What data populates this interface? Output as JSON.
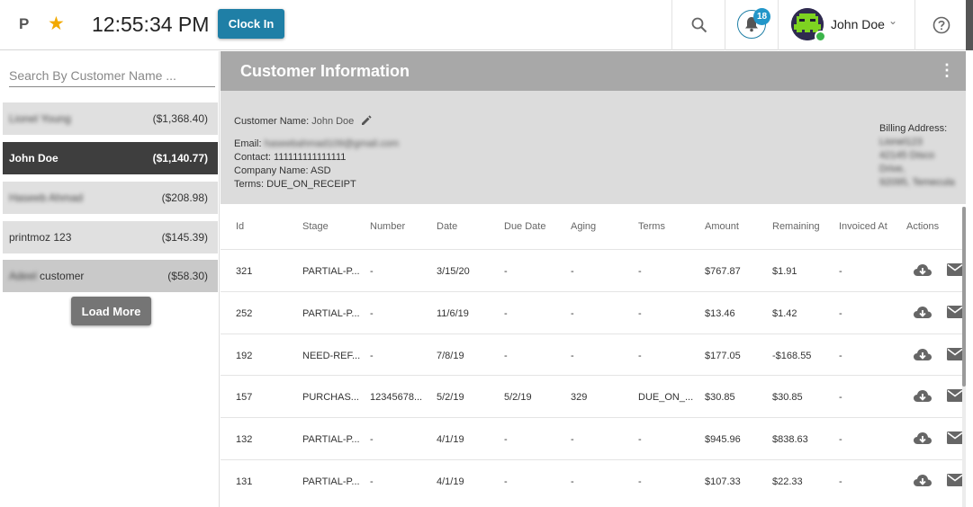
{
  "topbar": {
    "brand_letter": "P",
    "star_icon": "star-icon",
    "time": "12:55:34 PM",
    "clock_in_label": "Clock In",
    "notification_count": "18",
    "user_name": "John Doe",
    "accent_color": "#1f7fa6"
  },
  "sidebar": {
    "search_placeholder": "Search By Customer Name ...",
    "customers": [
      {
        "name": "Lionel Young",
        "balance": "($1,368.40)",
        "name_blurred": true
      },
      {
        "name": "John  Doe",
        "balance": "($1,140.77)",
        "name_blurred": false
      },
      {
        "name": "Haseeb Ahmad",
        "balance": "($208.98)",
        "name_blurred": true
      },
      {
        "name": "printmoz  123",
        "balance": "($145.39)",
        "name_blurred": false
      },
      {
        "name_blurred_part": "Adeel",
        "name_rest": "customer",
        "balance": "($58.30)"
      }
    ],
    "load_more_label": "Load More"
  },
  "customer_info": {
    "title": "Customer Information",
    "name_label": "Customer Name:",
    "name_value": "John  Doe",
    "email_label": "Email:",
    "email_value": "haseebahmad109@gmail.com",
    "contact_label": "Contact:",
    "contact_value": "111111111111111",
    "company_label": "Company Name:",
    "company_value": "ASD",
    "terms_label": "Terms:",
    "terms_value": "DUE_ON_RECEIPT",
    "billing_label": "Billing Address:",
    "billing_lines": [
      "Lionel123",
      "42145 Disco Drive,",
      "92095, Temecula"
    ]
  },
  "invoices": {
    "columns": [
      "Id",
      "Stage",
      "Number",
      "Date",
      "Due Date",
      "Aging",
      "Terms",
      "Amount",
      "Remaining",
      "Invoiced At",
      "Actions"
    ],
    "rows": [
      {
        "id": "321",
        "stage": "PARTIAL-P...",
        "number": "-",
        "date": "3/15/20",
        "due_date": "-",
        "aging": "-",
        "terms": "-",
        "amount": "$767.87",
        "remaining": "$1.91",
        "invoiced_at": "-"
      },
      {
        "id": "252",
        "stage": "PARTIAL-P...",
        "number": "-",
        "date": "11/6/19",
        "due_date": "-",
        "aging": "-",
        "terms": "-",
        "amount": "$13.46",
        "remaining": "$1.42",
        "invoiced_at": "-"
      },
      {
        "id": "192",
        "stage": "NEED-REF...",
        "number": "-",
        "date": "7/8/19",
        "due_date": "-",
        "aging": "-",
        "terms": "-",
        "amount": "$177.05",
        "remaining": "-$168.55",
        "invoiced_at": "-"
      },
      {
        "id": "157",
        "stage": "PURCHAS...",
        "number": "12345678...",
        "date": "5/2/19",
        "due_date": "5/2/19",
        "aging": "329",
        "terms": "DUE_ON_...",
        "amount": "$30.85",
        "remaining": "$30.85",
        "invoiced_at": "-"
      },
      {
        "id": "132",
        "stage": "PARTIAL-P...",
        "number": "-",
        "date": "4/1/19",
        "due_date": "-",
        "aging": "-",
        "terms": "-",
        "amount": "$945.96",
        "remaining": "$838.63",
        "invoiced_at": "-"
      },
      {
        "id": "131",
        "stage": "PARTIAL-P...",
        "number": "-",
        "date": "4/1/19",
        "due_date": "-",
        "aging": "-",
        "terms": "-",
        "amount": "$107.33",
        "remaining": "$22.33",
        "invoiced_at": "-"
      }
    ],
    "action_icons": [
      "cloud-download-icon",
      "mail-icon"
    ]
  }
}
